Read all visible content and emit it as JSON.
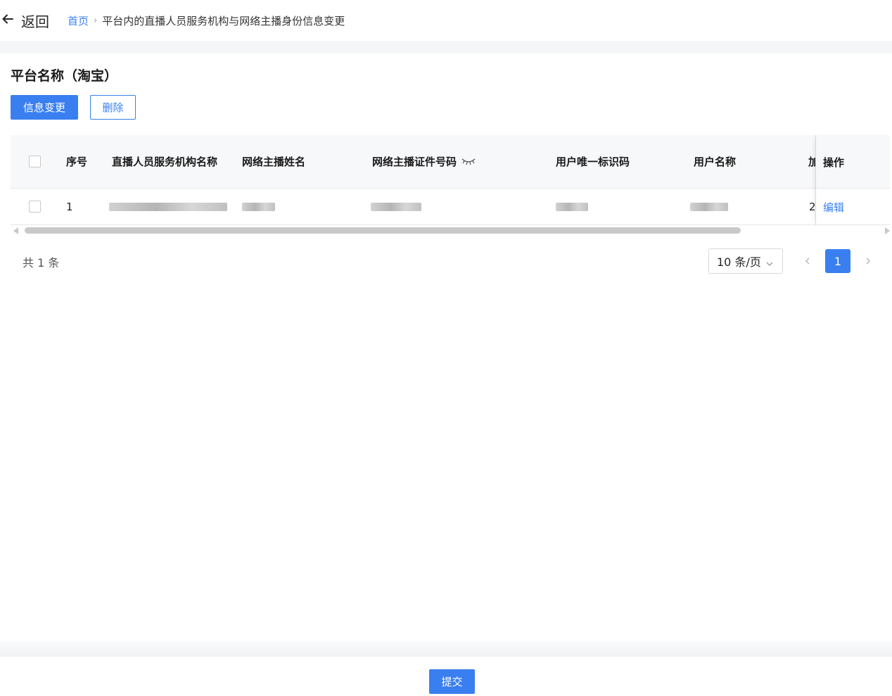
{
  "header": {
    "back_label": "返回",
    "breadcrumb_home": "首页",
    "breadcrumb_sep": "›",
    "breadcrumb_current": "平台内的直播人员服务机构与网络主播身份信息变更"
  },
  "section": {
    "title": "平台名称（淘宝）",
    "change_button": "信息变更",
    "delete_button": "删除"
  },
  "table": {
    "columns": [
      "序号",
      "直播人员服务机构名称",
      "网络主播姓名",
      "网络主播证件号码",
      "用户唯一标识码",
      "用户名称",
      "加",
      "操作"
    ],
    "rows": [
      {
        "index": "1",
        "truncated_value": "2",
        "action": "编辑"
      }
    ]
  },
  "pagination": {
    "total": "共 1 条",
    "page_size": "10 条/页",
    "current_page": "1"
  },
  "footer": {
    "submit_button": "提交"
  },
  "colors": {
    "primary": "#3a7ff0",
    "header_bg": "#f7f8fa"
  },
  "icons": [
    "back-arrow-icon",
    "eye-closed-icon",
    "chevron-down-icon",
    "chevron-left-icon",
    "chevron-right-icon"
  ]
}
